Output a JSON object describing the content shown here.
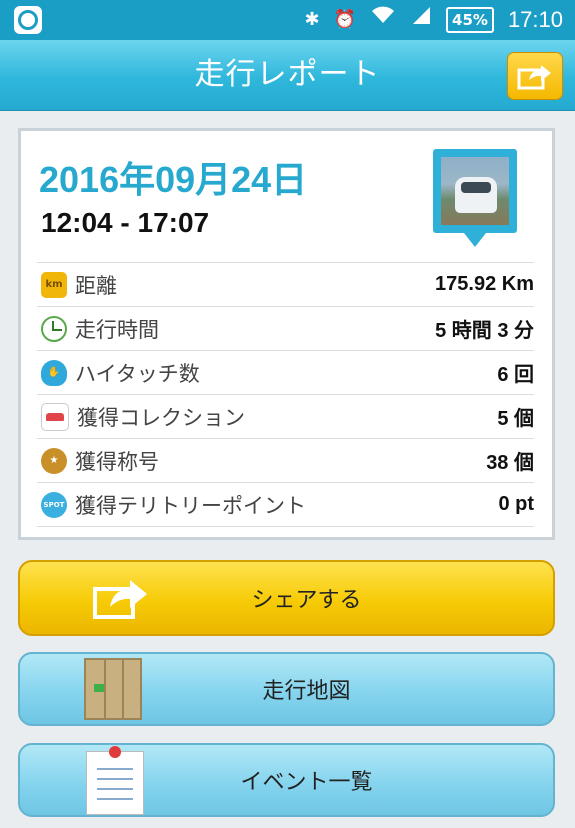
{
  "status_bar": {
    "battery": "45%",
    "time": "17:10",
    "icons": [
      "app-shield-icon",
      "bluetooth-icon",
      "alarm-icon",
      "wifi-icon",
      "signal-icon",
      "battery-icon"
    ]
  },
  "header": {
    "title": "走行レポート",
    "share_icon": "share-arrow-icon"
  },
  "report": {
    "date": "2016年09月24日",
    "time_range": "12:04 - 17:07",
    "rows": [
      {
        "icon": "km-icon",
        "icon_text": "km",
        "label": "距離",
        "value": "175.92 Km"
      },
      {
        "icon": "clock-icon",
        "label": "走行時間",
        "value": "5 時間 3 分"
      },
      {
        "icon": "hightouch-hand-icon",
        "label": "ハイタッチ数",
        "value": "6 回"
      },
      {
        "icon": "car-icon",
        "label": "獲得コレクション",
        "value": "5 個"
      },
      {
        "icon": "medal-icon",
        "label": "獲得称号",
        "value": "38 個"
      },
      {
        "icon": "spot-icon",
        "icon_text": "SPOT",
        "label": "獲得テリトリーポイント",
        "value": "0 pt"
      }
    ]
  },
  "buttons": {
    "share": "シェアする",
    "map": "走行地図",
    "events": "イベント一覧"
  },
  "colors": {
    "header": "#2fb7dc",
    "date": "#27a9cf",
    "share_button": "#f6cb06",
    "secondary_button": "#86d4ee"
  }
}
